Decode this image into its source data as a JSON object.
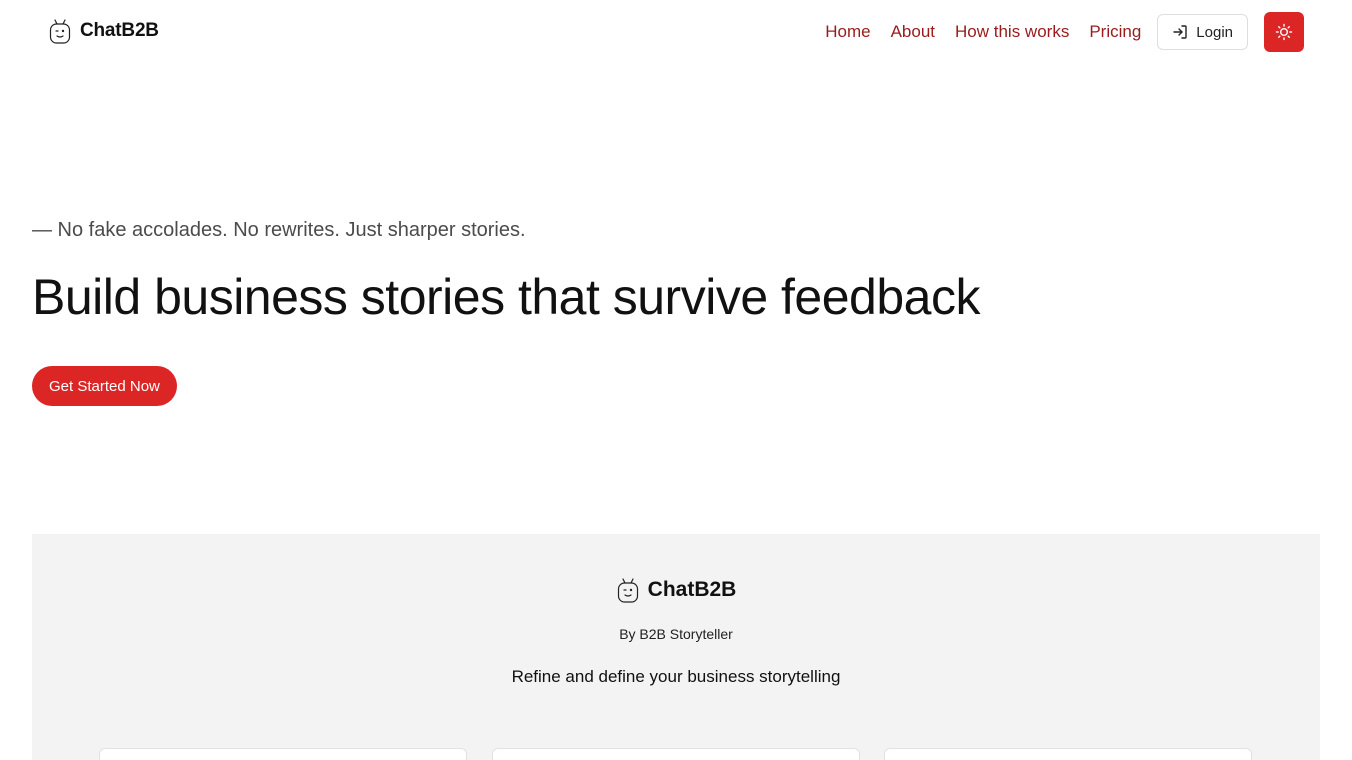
{
  "header": {
    "brand_name": "ChatB2B",
    "brand_icon": "robot-logo-icon",
    "nav": [
      {
        "label": "Home"
      },
      {
        "label": "About"
      },
      {
        "label": "How this works"
      },
      {
        "label": "Pricing"
      }
    ],
    "login_label": "Login",
    "login_icon": "login-arrow-icon",
    "theme_toggle_icon": "sun-icon"
  },
  "hero": {
    "tagline": "— No fake accolades. No rewrites. Just sharper stories.",
    "title": "Build business stories that survive feedback",
    "cta_label": "Get Started Now"
  },
  "footer": {
    "brand_name": "ChatB2B",
    "by_line": "By B2B Storyteller",
    "description": "Refine and define your business storytelling"
  },
  "colors": {
    "accent": "#dc2626",
    "nav_link": "#991b1b",
    "footer_bg": "#f3f3f3"
  }
}
